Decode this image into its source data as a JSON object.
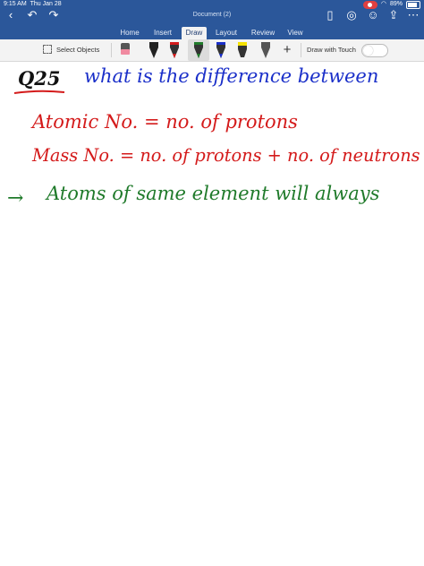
{
  "status": {
    "time": "9:15 AM",
    "date": "Thu Jan 28",
    "battery": "89%"
  },
  "app": {
    "document_title": "Document (2)"
  },
  "tabs": [
    {
      "label": "Home"
    },
    {
      "label": "Insert"
    },
    {
      "label": "Draw"
    },
    {
      "label": "Layout"
    },
    {
      "label": "Review"
    },
    {
      "label": "View"
    }
  ],
  "ribbon": {
    "select_objects": "Select Objects",
    "draw_with_touch": "Draw with Touch"
  },
  "handwriting": {
    "q_label": "Q25",
    "question": "what is the difference between",
    "atomic": "Atomic No. = no. of protons",
    "mass": "Mass  No. = no. of protons + no. of neutrons",
    "arrow": "→",
    "atoms": "Atoms of same element will always"
  },
  "colors": {
    "ribbon_blue": "#2b579a",
    "ink_black": "#111111",
    "ink_blue": "#1a2fc9",
    "ink_red": "#d41b1b",
    "ink_green": "#1f7a2a"
  }
}
